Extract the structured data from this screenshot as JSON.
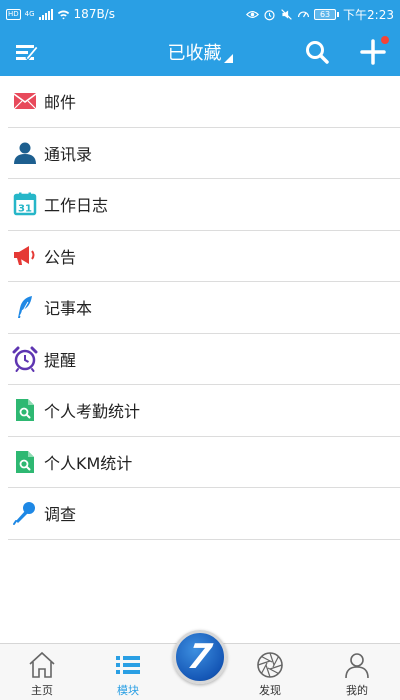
{
  "status_bar": {
    "badge": "HD",
    "signal": "4G",
    "speed": "187B/s",
    "battery": "63",
    "time": "下午2:23"
  },
  "header": {
    "title": "已收藏",
    "notification_dot": true
  },
  "colors": {
    "primary": "#2a9fe4",
    "mail": "#e8495b",
    "contacts": "#1d5f8f",
    "calendar": "#26b6c8",
    "announce": "#e53935",
    "note": "#1e88e5",
    "alarm": "#5e35b1",
    "stats": "#2eb872",
    "survey": "#1e88e5"
  },
  "list": {
    "items": [
      {
        "label": "邮件",
        "icon": "mail-icon"
      },
      {
        "label": "通讯录",
        "icon": "contacts-icon"
      },
      {
        "label": "工作日志",
        "icon": "calendar-icon"
      },
      {
        "label": "公告",
        "icon": "megaphone-icon"
      },
      {
        "label": "记事本",
        "icon": "feather-icon"
      },
      {
        "label": "提醒",
        "icon": "alarm-clock-icon"
      },
      {
        "label": "个人考勤统计",
        "icon": "doc-search-icon"
      },
      {
        "label": "个人KM统计",
        "icon": "doc-search-icon"
      },
      {
        "label": "调查",
        "icon": "microphone-icon"
      }
    ]
  },
  "tabbar": {
    "home": "主页",
    "modules": "模块",
    "center": "7",
    "discover": "发现",
    "mine": "我的"
  }
}
